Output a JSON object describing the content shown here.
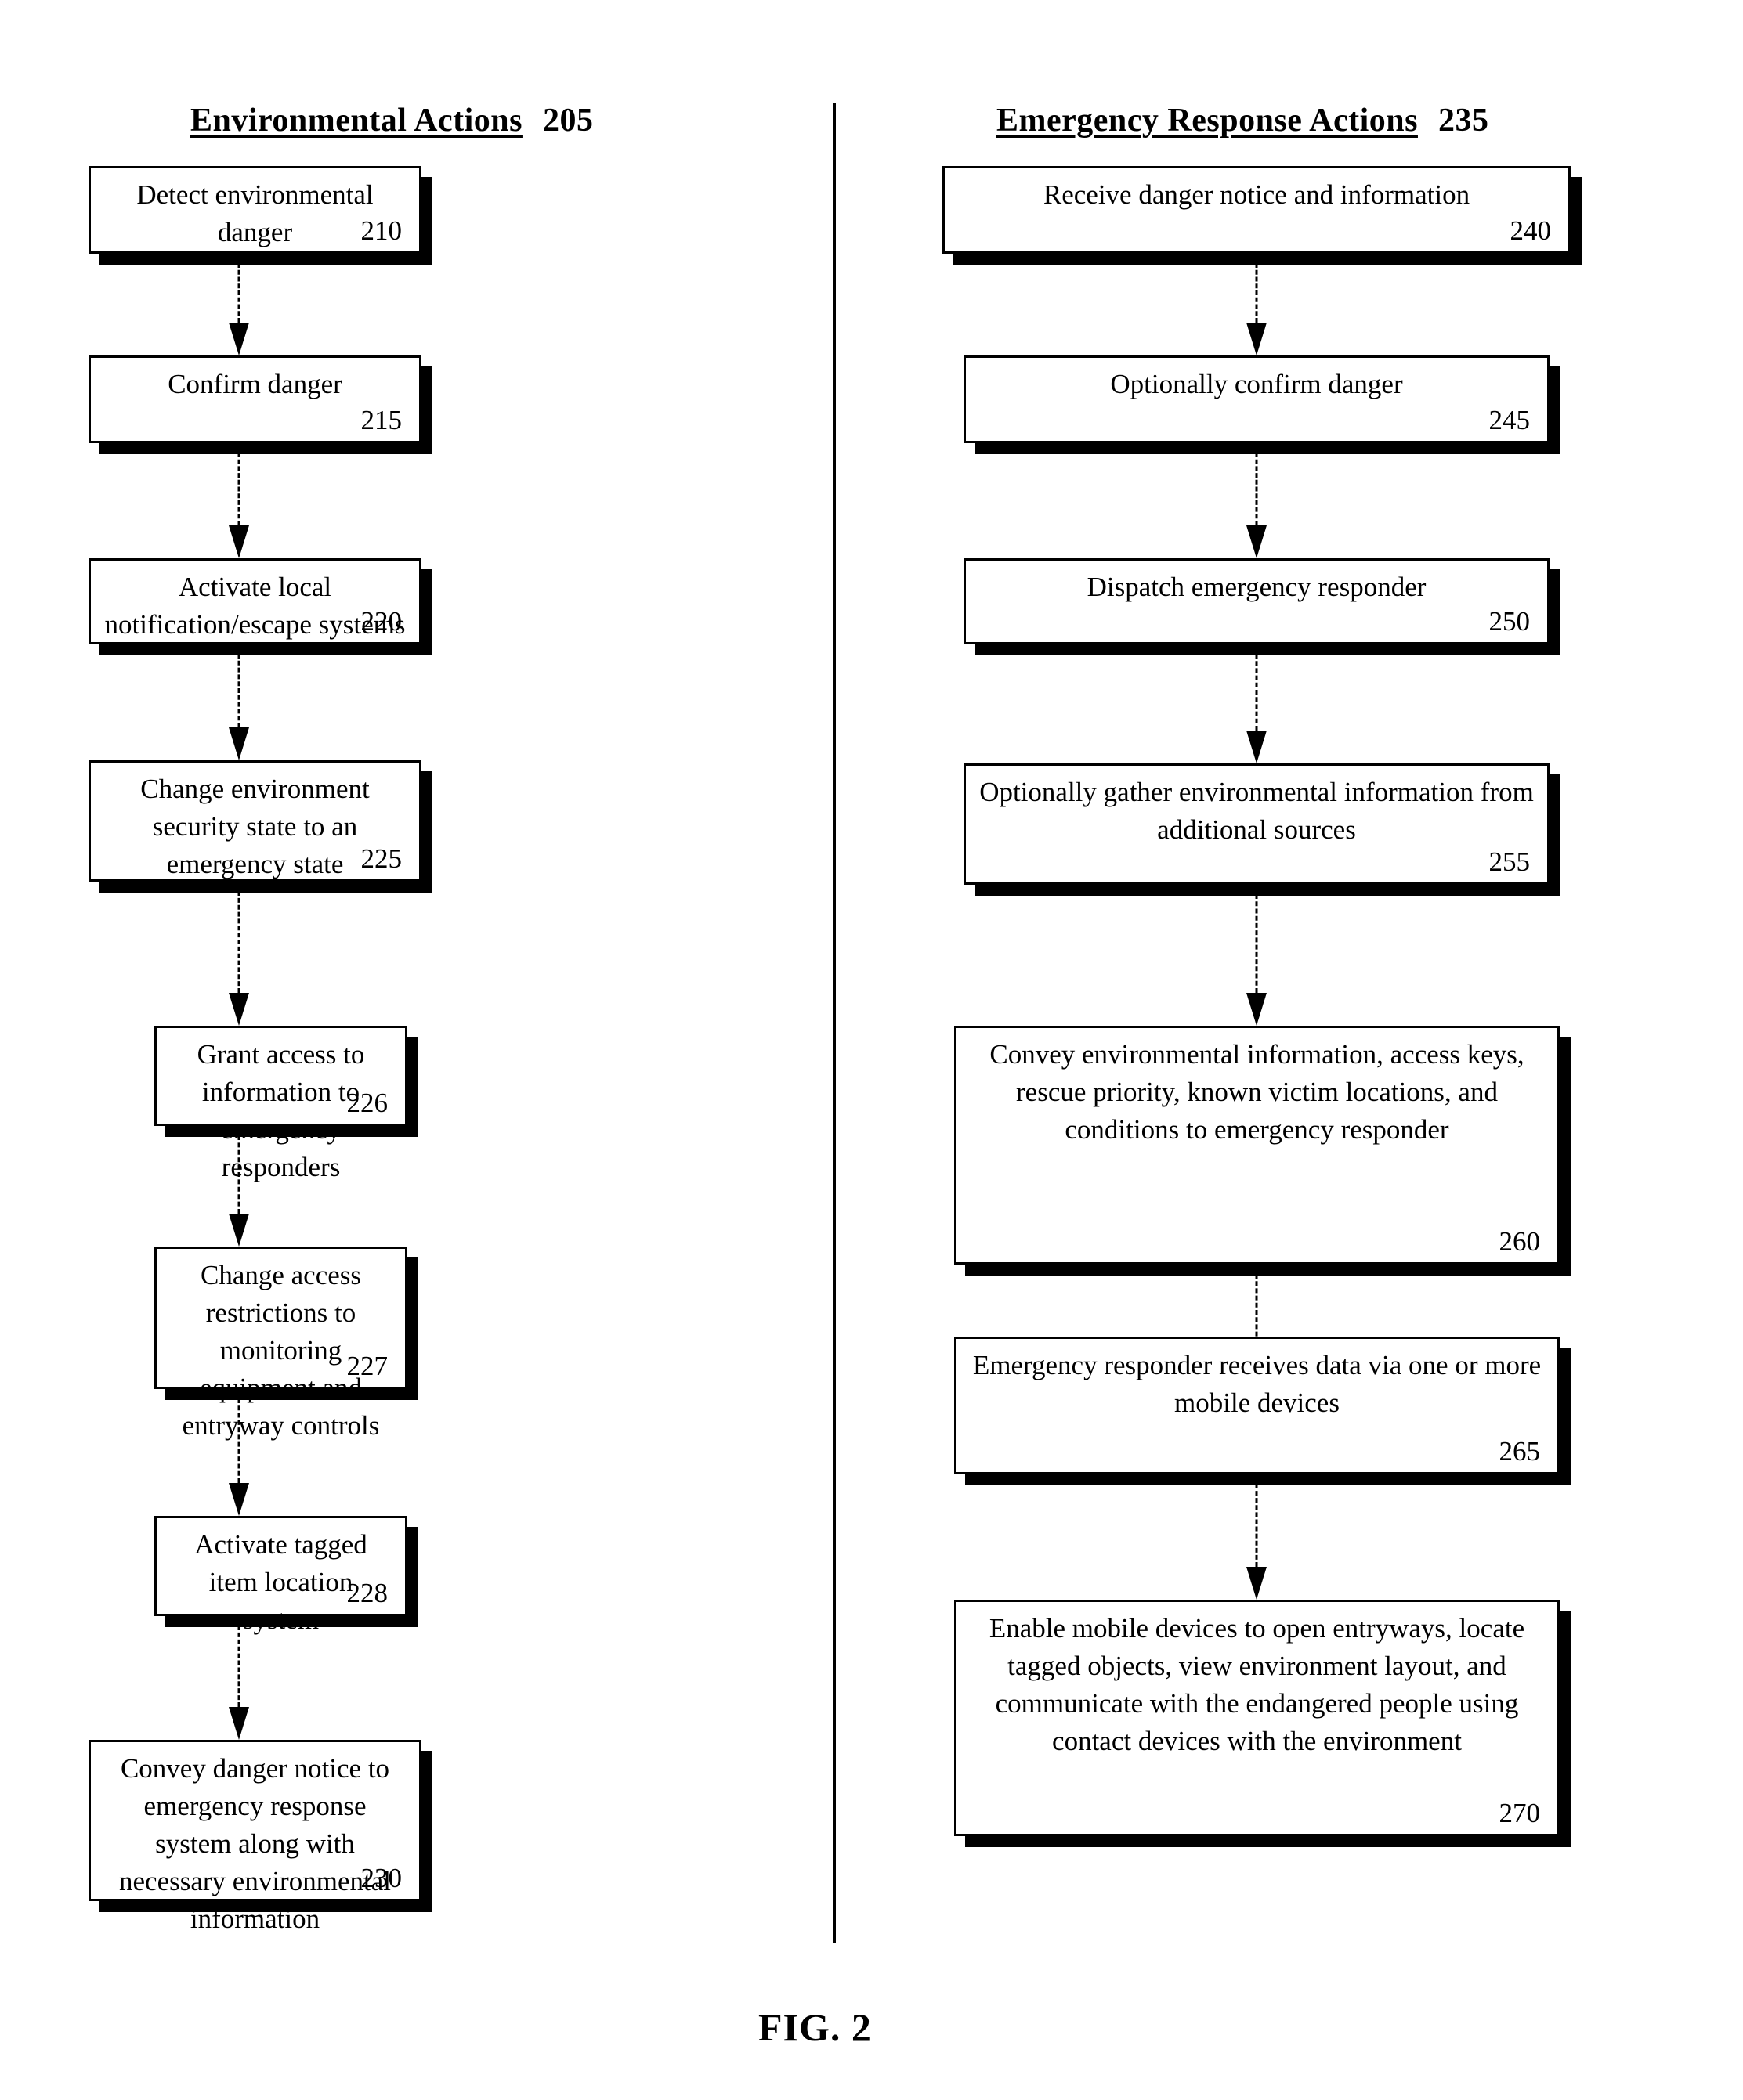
{
  "figure": {
    "caption": "FIG. 2"
  },
  "columns": [
    {
      "id": "environmental-actions",
      "title": "Environmental Actions",
      "ref": "205",
      "steps": [
        {
          "text": "Detect environmental danger",
          "ref": "210"
        },
        {
          "text": "Confirm danger",
          "ref": "215"
        },
        {
          "text": "Activate local notification/escape systems",
          "ref": "220"
        },
        {
          "text": "Change environment security state to an emergency state",
          "ref": "225"
        },
        {
          "text": "Grant access to information to emergency responders",
          "ref": "226"
        },
        {
          "text": "Change access restrictions to monitoring equipment and entryway controls",
          "ref": "227"
        },
        {
          "text": "Activate tagged item location system",
          "ref": "228"
        },
        {
          "text": "Convey danger notice to emergency response system along with necessary environmental information",
          "ref": "230"
        }
      ]
    },
    {
      "id": "emergency-response-actions",
      "title": "Emergency Response Actions",
      "ref": "235",
      "steps": [
        {
          "text": "Receive danger notice and information",
          "ref": "240"
        },
        {
          "text": "Optionally confirm danger",
          "ref": "245"
        },
        {
          "text": "Dispatch emergency responder",
          "ref": "250"
        },
        {
          "text": "Optionally gather environmental information from additional sources",
          "ref": "255"
        },
        {
          "text": "Convey environmental information, access keys, rescue priority, known victim locations, and conditions to emergency responder",
          "ref": "260"
        },
        {
          "text": "Emergency responder receives data via one or more mobile devices",
          "ref": "265"
        },
        {
          "text": "Enable mobile devices to open entryways, locate tagged objects, view environment layout, and communicate with the endangered people using contact devices with the environment",
          "ref": "270"
        }
      ]
    }
  ],
  "style": {
    "ink": "#000000",
    "paper": "#ffffff"
  }
}
